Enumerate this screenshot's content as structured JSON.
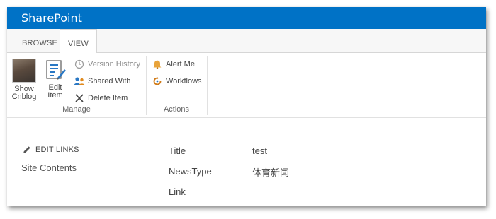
{
  "suite_bar": {
    "brand": "SharePoint"
  },
  "ribbon": {
    "tabs": [
      {
        "label": "BROWSE",
        "active": false
      },
      {
        "label": "VIEW",
        "active": true
      }
    ],
    "manage": {
      "label": "Manage",
      "show_button": [
        "Show",
        "Cnblog"
      ],
      "edit_button": [
        "Edit",
        "Item"
      ],
      "version_history": "Version History",
      "shared_with": "Shared With",
      "delete_item": "Delete Item"
    },
    "actions": {
      "label": "Actions",
      "alert_me": "Alert Me",
      "workflows": "Workflows"
    }
  },
  "left_nav": {
    "edit_links": "EDIT LINKS",
    "site_contents": "Site Contents"
  },
  "item": {
    "fields": [
      {
        "label": "Title",
        "value": "test"
      },
      {
        "label": "NewsType",
        "value": "体育新闻"
      },
      {
        "label": "Link",
        "value": ""
      }
    ]
  },
  "colors": {
    "suite_bar": "#0072c6",
    "text": "#444444"
  }
}
